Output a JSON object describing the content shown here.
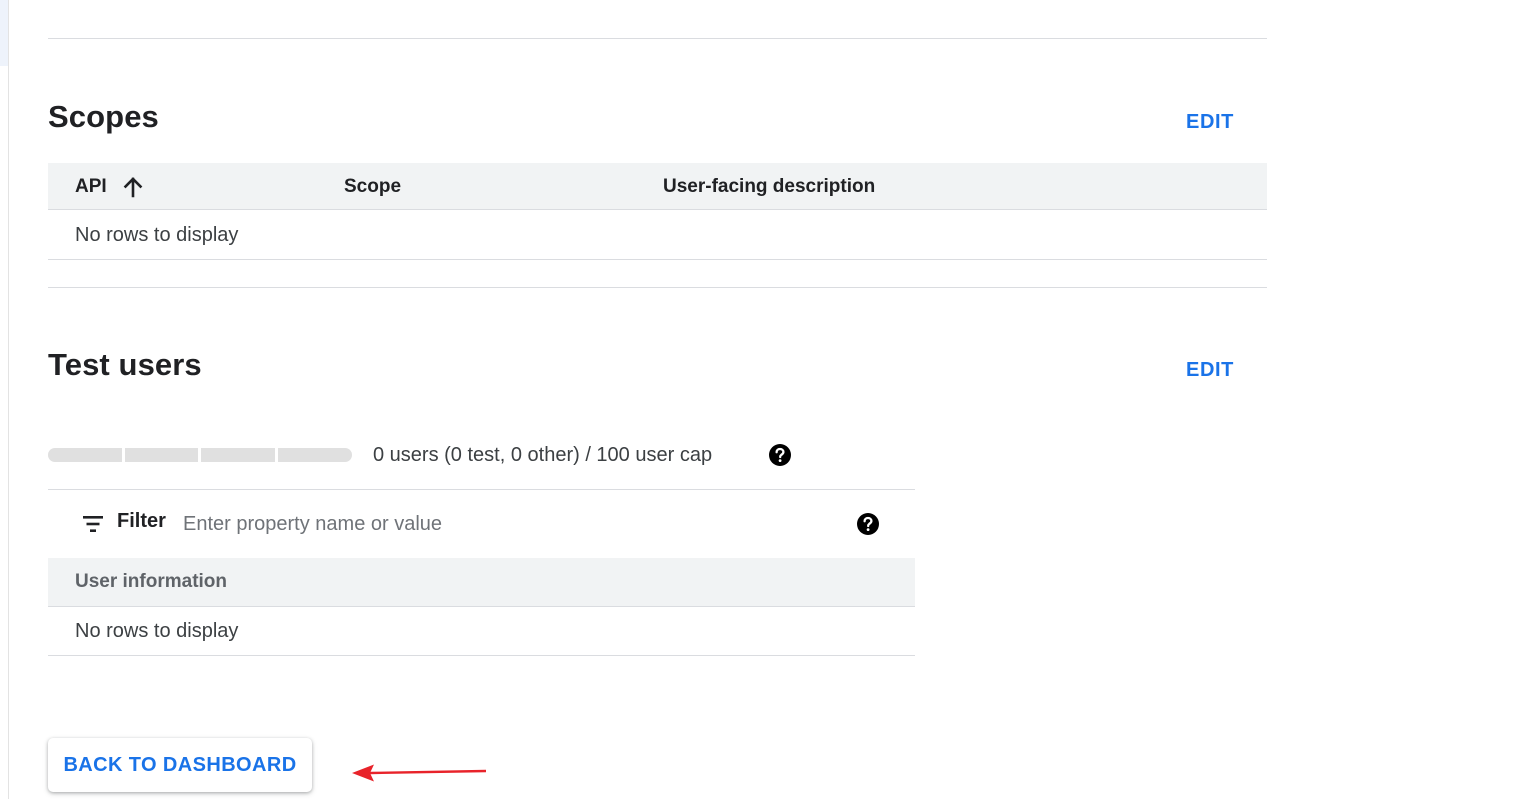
{
  "scopes": {
    "title": "Scopes",
    "edit_label": "EDIT",
    "columns": [
      "API",
      "Scope",
      "User-facing description"
    ],
    "empty_text": "No rows to display"
  },
  "test_users": {
    "title": "Test users",
    "edit_label": "EDIT",
    "usage": {
      "text": "0 users (0 test, 0 other) / 100 user cap",
      "fill_fraction": 0
    },
    "filter": {
      "label": "Filter",
      "placeholder": "Enter property name or value",
      "value": ""
    },
    "table": {
      "columns": [
        "User information"
      ],
      "empty_text": "No rows to display"
    }
  },
  "footer": {
    "back_label": "BACK TO DASHBOARD"
  },
  "icons": {
    "sort": "arrow-up-icon",
    "help": "help-circle-icon",
    "filter": "filter-icon",
    "annotation": "red-arrow-annotation"
  },
  "colors": {
    "accent": "#1a73e8",
    "annotation": "#e8232a",
    "header_bg": "#f1f3f4"
  }
}
